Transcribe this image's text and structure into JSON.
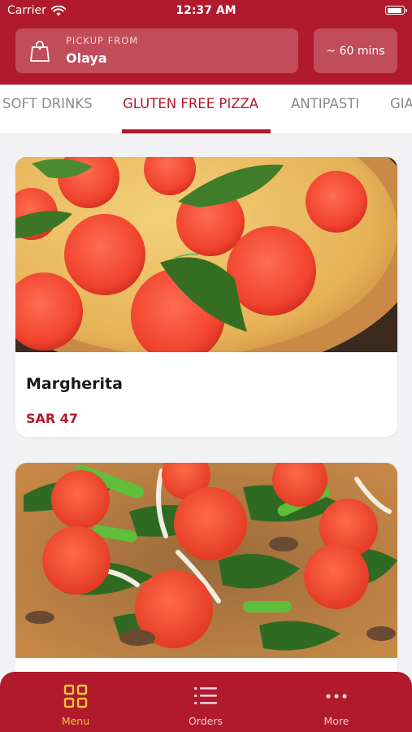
{
  "status_bar": {
    "carrier": "Carrier",
    "time": "12:37 AM"
  },
  "header": {
    "pickup_label": "PICKUP FROM",
    "pickup_location": "Olaya",
    "eta": "~ 60 mins"
  },
  "categories": {
    "tabs": [
      {
        "label": "SOFT DRINKS"
      },
      {
        "label": "GLUTEN FREE PIZZA"
      },
      {
        "label": "ANTIPASTI"
      },
      {
        "label": "GIA"
      }
    ],
    "active_index": 1
  },
  "menu_items": [
    {
      "name": "Margherita",
      "price": "SAR 47"
    },
    {
      "name": "",
      "price": ""
    }
  ],
  "bottom_nav": [
    {
      "label": "Menu",
      "icon": "grid-icon",
      "active": true
    },
    {
      "label": "Orders",
      "icon": "list-icon",
      "active": false
    },
    {
      "label": "More",
      "icon": "more-dots-icon",
      "active": false
    }
  ],
  "colors": {
    "brand": "#b01a2c",
    "active_tab_icon": "#f2c53d",
    "price": "#b01a2c"
  }
}
